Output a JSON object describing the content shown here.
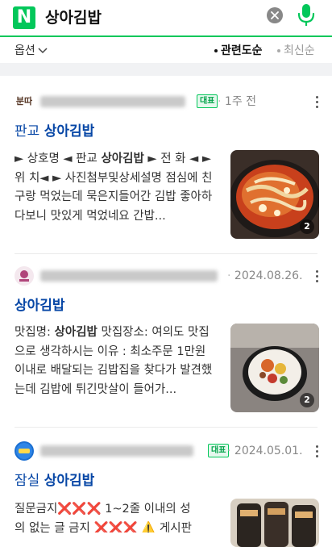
{
  "header": {
    "logo": "N",
    "query": "상아김밥",
    "icons": [
      "clear-icon",
      "mic-icon"
    ],
    "brand_color": "#03c75a"
  },
  "filter": {
    "options_label": "옵션",
    "sort_selected": "관련도순",
    "sort_other": "최신순"
  },
  "results": [
    {
      "logo_text": "분따",
      "badge": "대표",
      "date": "1주 전",
      "title_prefix": "판교 ",
      "title_bold": "상아김밥",
      "desc_parts": [
        "► 상호명 ◄ 판교 ",
        "상아김밥",
        " ► 전 화 ◄ ► 위 치◄ ► 사진첨부및상세설명 점심에 친구랑 먹었는데 묵은지들어간 김밥 좋아하다보니 맛있게 먹었네요 간밥..."
      ],
      "image_count": "2"
    },
    {
      "badge": "",
      "date": "2024.08.26.",
      "title_prefix": "",
      "title_bold": "상아김밥",
      "desc_parts": [
        "맛집명: ",
        "상아김밥",
        " 맛집장소: 여의도 맛집으로 생각하시는 이유 : 최소주문 1만원 이내로 배달되는 김밥집을 찾다가 발견했는데 김밥에 튀긴맛살이 들어가..."
      ],
      "image_count": "2"
    },
    {
      "badge": "대표",
      "date": "2024.05.01.",
      "title_prefix": "잠실 ",
      "title_bold": "상아김밥",
      "desc_line1": "질문금지❌❌❌ 1~2줄 이내의 성",
      "desc_line2": "의 없는 글 금지 ❌❌❌ ⚠️ 게시판"
    }
  ]
}
